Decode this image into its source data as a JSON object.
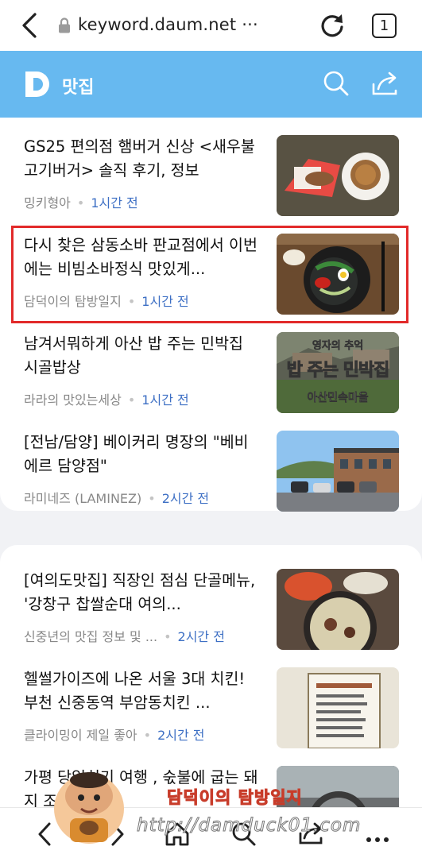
{
  "browser": {
    "url": "keyword.daum.net ···",
    "tab_count": "1"
  },
  "header": {
    "title": "맛집"
  },
  "articles": [
    {
      "title": "GS25 편의점 햄버거 신상 <새우불고기버거> 솔직 후기, 정보",
      "source": "밍키형아",
      "time": "1시간 전"
    },
    {
      "title": "다시 찾은 삼동소바 판교점에서 이번에는 비빔소바정식 맛있게...",
      "source": "담덕이의 탐방일지",
      "time": "1시간 전"
    },
    {
      "title": "남겨서뭐하게 아산 밥 주는 민박집 시골밥상",
      "source": "라라의 맛있는세상",
      "time": "1시간 전"
    },
    {
      "title": "[전남/담양] 베이커리 명장의 \"베비에르 담양점\"",
      "source": "라미네즈 (LAMINEZ)",
      "time": "2시간 전"
    },
    {
      "title": "[여의도맛집] 직장인 점심 단골메뉴, '강창구 찹쌀순대 여의...",
      "source": "신중년의 맛집 정보 및 ...",
      "time": "2시간 전"
    },
    {
      "title": "헬썰가이즈에 나온 서울 3대 치킨! 부천 신중동역 부암동치킨 ...",
      "source": "클라이밍이 제일 좋아",
      "time": "2시간 전"
    },
    {
      "title": "가평 당일치기 여행 , 숛불에 굽는 돼지 조원",
      "source": "",
      "time": ""
    }
  ],
  "thumb_overlays": {
    "minbak_line1": "영자의 추억",
    "minbak_line2": "밥 주는 민박집",
    "minbak_line3": "아산민속마을"
  },
  "watermark": {
    "name": "담덕이의 탐방일지",
    "url": "http://damduck01.com"
  },
  "colors": {
    "header_bg": "#67b9f0",
    "time_text": "#3d6fc4",
    "highlight_border": "#e22a2a"
  },
  "icons": [
    "back-icon",
    "lock-icon",
    "reload-icon",
    "tabs-icon",
    "daum-logo",
    "search-icon",
    "share-icon",
    "home-icon",
    "menu-icon"
  ]
}
